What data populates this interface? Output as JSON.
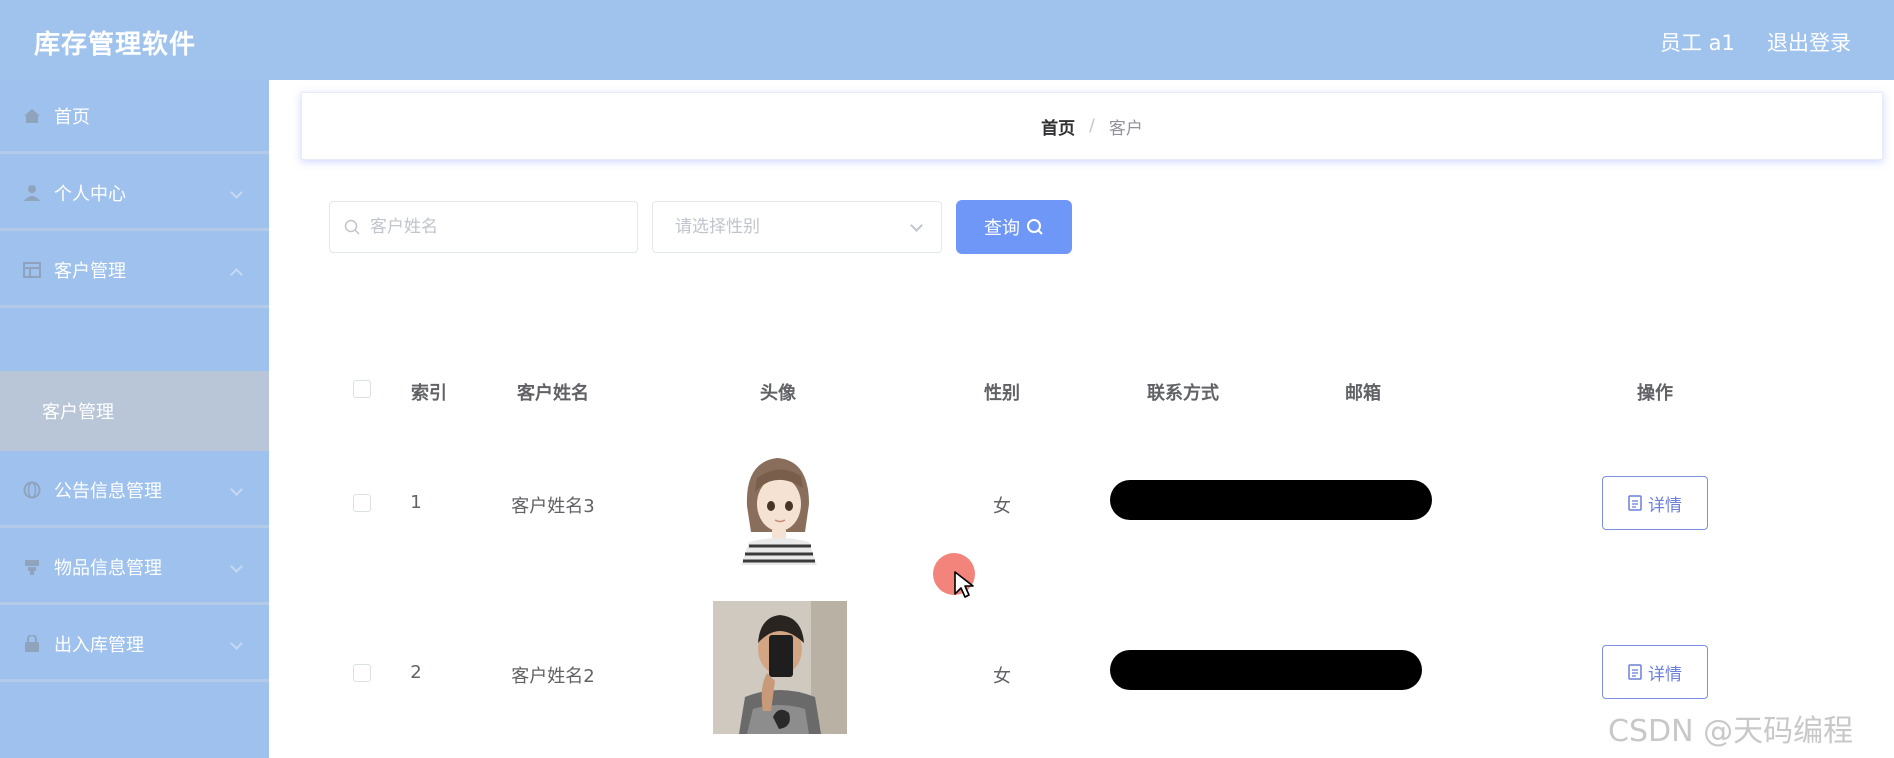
{
  "header": {
    "app_title": "库存管理软件",
    "user_name": "员工 a1",
    "logout_label": "退出登录"
  },
  "sidebar": {
    "items": [
      {
        "label": "首页",
        "icon": "home-icon",
        "expandable": false
      },
      {
        "label": "个人中心",
        "icon": "user-icon",
        "expandable": true
      },
      {
        "label": "客户管理",
        "icon": "table-icon",
        "expandable": true,
        "expanded": true,
        "children": [
          {
            "label": "客户管理",
            "active": true
          }
        ]
      },
      {
        "label": "公告信息管理",
        "icon": "globe-icon",
        "expandable": true
      },
      {
        "label": "物品信息管理",
        "icon": "box-icon",
        "expandable": true
      },
      {
        "label": "出入库管理",
        "icon": "lock-icon",
        "expandable": true
      }
    ]
  },
  "breadcrumb": {
    "home": "首页",
    "separator": "/",
    "current": "客户"
  },
  "search": {
    "name_placeholder": "客户姓名",
    "name_value": "",
    "gender_placeholder": "请选择性别",
    "gender_value": "",
    "query_label": "查询"
  },
  "table": {
    "columns": [
      "索引",
      "客户姓名",
      "头像",
      "性别",
      "联系方式",
      "邮箱",
      "操作"
    ],
    "rows": [
      {
        "index": "1",
        "name": "客户姓名3",
        "avatar": "cartoon-girl-avatar",
        "gender": "女",
        "contact": "",
        "email": "",
        "action": "详情"
      },
      {
        "index": "2",
        "name": "客户姓名2",
        "avatar": "mirror-selfie-photo",
        "gender": "女",
        "contact": "",
        "email": "",
        "action": "详情"
      }
    ]
  },
  "watermark": "CSDN @天码编程",
  "colors": {
    "header_bg": "#a0c3ee",
    "sidebar_bg": "#9ec1ed",
    "submenu_active_bg": "#b9c6d8",
    "primary_button": "#6f97f7",
    "detail_border": "#7d8fe0"
  }
}
